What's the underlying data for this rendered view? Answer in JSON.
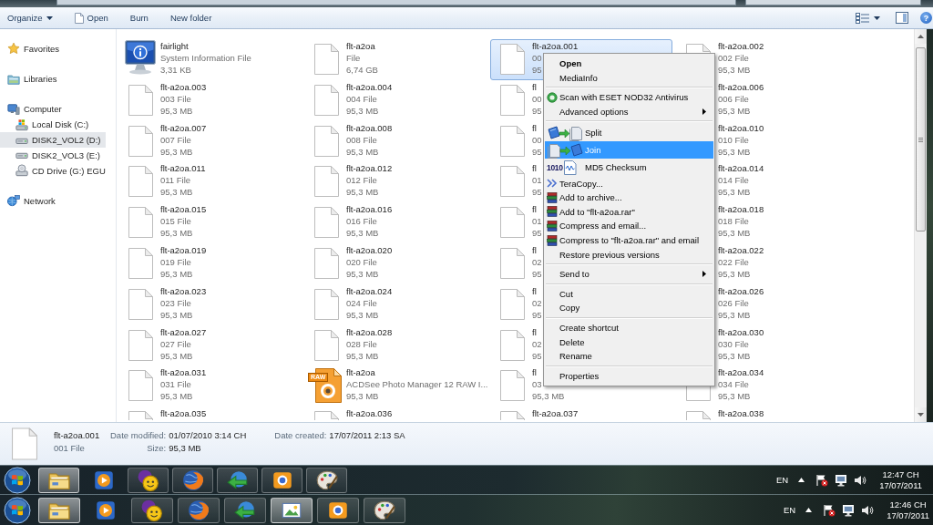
{
  "toolbar": {
    "buttons": [
      {
        "label": "Organize",
        "kind": "dropdown"
      },
      {
        "label": "Open",
        "kind": "icon"
      },
      {
        "label": "Burn",
        "kind": "plain"
      },
      {
        "label": "New folder",
        "kind": "plain"
      }
    ],
    "help": "?"
  },
  "sidebar": {
    "sections": [
      {
        "label": "Favorites",
        "kind": "favorites",
        "selected": false
      },
      {
        "label": "Libraries",
        "kind": "libraries",
        "selected": false
      },
      {
        "label": "Computer",
        "kind": "computer",
        "selected": false,
        "children": [
          {
            "label": "Local Disk (C:)",
            "kind": "system-drive",
            "selected": false
          },
          {
            "label": "DISK2_VOL2 (D:)",
            "kind": "drive",
            "selected": true
          },
          {
            "label": "DISK2_VOL3 (E:)",
            "kind": "drive",
            "selected": false
          },
          {
            "label": "CD Drive (G:) EGU",
            "kind": "optical-drive",
            "selected": false
          }
        ]
      },
      {
        "label": "Network",
        "kind": "network",
        "selected": false
      }
    ]
  },
  "files": {
    "items": [
      {
        "name": "fairlight",
        "type": "System Information File",
        "size": "3,31 KB",
        "kind": "sysinfo",
        "selected": false
      },
      {
        "name": "flt-a2oa",
        "type": "File",
        "size": "6,74 GB",
        "kind": "file",
        "selected": false
      },
      {
        "name": "flt-a2oa.001",
        "type": "00",
        "size": "95",
        "kind": "file",
        "selected": true
      },
      {
        "name": "flt-a2oa.002",
        "type": "002 File",
        "size": "95,3 MB",
        "kind": "file",
        "selected": false
      },
      {
        "name": "flt-a2oa.003",
        "type": "003 File",
        "size": "95,3 MB",
        "kind": "file",
        "selected": false
      },
      {
        "name": "flt-a2oa.004",
        "type": "004 File",
        "size": "95,3 MB",
        "kind": "file",
        "selected": false
      },
      {
        "name": "fl",
        "type": "00",
        "size": "95",
        "kind": "file",
        "selected": false
      },
      {
        "name": "flt-a2oa.006",
        "type": "006 File",
        "size": "95,3 MB",
        "kind": "covered",
        "selected": false
      },
      {
        "name": "flt-a2oa.007",
        "type": "007 File",
        "size": "95,3 MB",
        "kind": "file",
        "selected": false
      },
      {
        "name": "flt-a2oa.008",
        "type": "008 File",
        "size": "95,3 MB",
        "kind": "file",
        "selected": false
      },
      {
        "name": "fl",
        "type": "00",
        "size": "95",
        "kind": "file",
        "selected": false
      },
      {
        "name": "flt-a2oa.010",
        "type": "010 File",
        "size": "95,3 MB",
        "kind": "covered",
        "selected": false
      },
      {
        "name": "flt-a2oa.011",
        "type": "011 File",
        "size": "95,3 MB",
        "kind": "file",
        "selected": false
      },
      {
        "name": "flt-a2oa.012",
        "type": "012 File",
        "size": "95,3 MB",
        "kind": "file",
        "selected": false
      },
      {
        "name": "fl",
        "type": "01",
        "size": "95",
        "kind": "file",
        "selected": false
      },
      {
        "name": "flt-a2oa.014",
        "type": "014 File",
        "size": "95,3 MB",
        "kind": "covered",
        "selected": false
      },
      {
        "name": "flt-a2oa.015",
        "type": "015 File",
        "size": "95,3 MB",
        "kind": "file",
        "selected": false
      },
      {
        "name": "flt-a2oa.016",
        "type": "016 File",
        "size": "95,3 MB",
        "kind": "file",
        "selected": false
      },
      {
        "name": "fl",
        "type": "01",
        "size": "95",
        "kind": "file",
        "selected": false
      },
      {
        "name": "flt-a2oa.018",
        "type": "018 File",
        "size": "95,3 MB",
        "kind": "covered",
        "selected": false
      },
      {
        "name": "flt-a2oa.019",
        "type": "019 File",
        "size": "95,3 MB",
        "kind": "file",
        "selected": false
      },
      {
        "name": "flt-a2oa.020",
        "type": "020 File",
        "size": "95,3 MB",
        "kind": "file",
        "selected": false
      },
      {
        "name": "fl",
        "type": "02",
        "size": "95",
        "kind": "file",
        "selected": false
      },
      {
        "name": "flt-a2oa.022",
        "type": "022 File",
        "size": "95,3 MB",
        "kind": "covered",
        "selected": false
      },
      {
        "name": "flt-a2oa.023",
        "type": "023 File",
        "size": "95,3 MB",
        "kind": "file",
        "selected": false
      },
      {
        "name": "flt-a2oa.024",
        "type": "024 File",
        "size": "95,3 MB",
        "kind": "file",
        "selected": false
      },
      {
        "name": "fl",
        "type": "02",
        "size": "95",
        "kind": "file",
        "selected": false
      },
      {
        "name": "flt-a2oa.026",
        "type": "026 File",
        "size": "95,3 MB",
        "kind": "covered",
        "selected": false
      },
      {
        "name": "flt-a2oa.027",
        "type": "027 File",
        "size": "95,3 MB",
        "kind": "file",
        "selected": false
      },
      {
        "name": "flt-a2oa.028",
        "type": "028 File",
        "size": "95,3 MB",
        "kind": "file",
        "selected": false
      },
      {
        "name": "fl",
        "type": "02",
        "size": "95",
        "kind": "file",
        "selected": false
      },
      {
        "name": "flt-a2oa.030",
        "type": "030 File",
        "size": "95,3 MB",
        "kind": "covered",
        "selected": false
      },
      {
        "name": "flt-a2oa.031",
        "type": "031 File",
        "size": "95,3 MB",
        "kind": "file",
        "selected": false
      },
      {
        "name": "flt-a2oa",
        "type": "ACDSee Photo Manager 12 RAW I...",
        "size": "95,3 MB",
        "kind": "raw",
        "badge": "RAW",
        "selected": false
      },
      {
        "name": "fl",
        "type": "03",
        "size": "95,3 MB",
        "kind": "file",
        "selected": false
      },
      {
        "name": "flt-a2oa.034",
        "type": "034 File",
        "size": "95,3 MB",
        "kind": "file",
        "selected": false
      },
      {
        "name": "flt-a2oa.035",
        "kind": "file",
        "selected": false
      },
      {
        "name": "flt-a2oa.036",
        "kind": "file",
        "selected": false
      },
      {
        "name": "flt-a2oa.037",
        "kind": "file",
        "selected": false
      },
      {
        "name": "flt-a2oa.038",
        "kind": "file",
        "selected": false
      }
    ]
  },
  "context_menu": {
    "groups": [
      {
        "items": [
          {
            "label": "Open",
            "kind": "plain",
            "default": true,
            "submenu": false,
            "selected": false
          },
          {
            "label": "MediaInfo",
            "kind": "plain",
            "default": false,
            "submenu": false,
            "selected": false
          }
        ]
      },
      {
        "items": [
          {
            "label": "Scan with ESET NOD32 Antivirus",
            "kind": "antivirus",
            "default": false,
            "submenu": false,
            "selected": false
          },
          {
            "label": "Advanced options",
            "kind": "plain",
            "default": false,
            "submenu": true,
            "selected": false
          }
        ]
      },
      {
        "items": [
          {
            "label": "Split",
            "kind": "split",
            "default": false,
            "submenu": false,
            "selected": false
          },
          {
            "label": "Join",
            "kind": "join",
            "default": false,
            "submenu": false,
            "selected": true
          },
          {
            "label": "MD5 Checksum",
            "kind": "checksum",
            "badge": "1010",
            "default": false,
            "submenu": false,
            "selected": false
          },
          {
            "label": "TeraCopy...",
            "kind": "copier",
            "default": false,
            "submenu": false,
            "selected": false
          },
          {
            "label": "Add to archive...",
            "kind": "archive",
            "default": false,
            "submenu": false,
            "selected": false
          },
          {
            "label": "Add to \"flt-a2oa.rar\"",
            "kind": "archive",
            "default": false,
            "submenu": false,
            "selected": false
          },
          {
            "label": "Compress and email...",
            "kind": "archive",
            "default": false,
            "submenu": false,
            "selected": false
          },
          {
            "label": "Compress to \"flt-a2oa.rar\" and email",
            "kind": "archive",
            "default": false,
            "submenu": false,
            "selected": false
          },
          {
            "label": "Restore previous versions",
            "kind": "plain",
            "default": false,
            "submenu": false,
            "selected": false
          }
        ]
      },
      {
        "items": [
          {
            "label": "Send to",
            "kind": "plain",
            "default": false,
            "submenu": true,
            "selected": false
          }
        ]
      },
      {
        "items": [
          {
            "label": "Cut",
            "kind": "plain",
            "default": false,
            "submenu": false,
            "selected": false
          },
          {
            "label": "Copy",
            "kind": "plain",
            "default": false,
            "submenu": false,
            "selected": false
          }
        ]
      },
      {
        "items": [
          {
            "label": "Create shortcut",
            "kind": "plain",
            "default": false,
            "submenu": false,
            "selected": false
          },
          {
            "label": "Delete",
            "kind": "plain",
            "default": false,
            "submenu": false,
            "selected": false
          },
          {
            "label": "Rename",
            "kind": "plain",
            "default": false,
            "submenu": false,
            "selected": false
          }
        ]
      },
      {
        "items": [
          {
            "label": "Properties",
            "kind": "plain",
            "default": false,
            "submenu": false,
            "selected": false
          }
        ]
      }
    ]
  },
  "details": {
    "name": "flt-a2oa.001",
    "type": "001 File",
    "fields": [
      {
        "label": "Date modified:",
        "value": "01/07/2010 3:14 CH"
      },
      {
        "label": "Size:",
        "value": "95,3 MB"
      },
      {
        "label": "Date created:",
        "value": "17/07/2011 2:13 SA"
      }
    ]
  },
  "taskbars": [
    {
      "buttons": [
        {
          "kind": "file-manager",
          "running": true,
          "active": true
        },
        {
          "kind": "media-player",
          "running": false,
          "active": false
        },
        {
          "kind": "messenger",
          "running": true,
          "active": false
        },
        {
          "kind": "browser",
          "running": true,
          "active": false
        },
        {
          "kind": "download-manager",
          "running": true,
          "active": false
        },
        {
          "kind": "photo-manager",
          "running": true,
          "active": false
        },
        {
          "kind": "paint",
          "running": true,
          "active": false
        }
      ],
      "language": "EN",
      "time": "12:47 CH",
      "date": "17/07/2011"
    },
    {
      "buttons": [
        {
          "kind": "file-manager",
          "running": true,
          "active": true
        },
        {
          "kind": "media-player",
          "running": false,
          "active": false
        },
        {
          "kind": "messenger",
          "running": true,
          "active": false
        },
        {
          "kind": "browser",
          "running": true,
          "active": false
        },
        {
          "kind": "download-manager",
          "running": true,
          "active": false
        },
        {
          "kind": "image-viewer",
          "running": true,
          "active": true
        },
        {
          "kind": "photo-manager",
          "running": true,
          "active": false
        },
        {
          "kind": "paint",
          "running": true,
          "active": false
        }
      ],
      "language": "EN",
      "time": "12:46 CH",
      "date": "17/07/2011"
    }
  ]
}
